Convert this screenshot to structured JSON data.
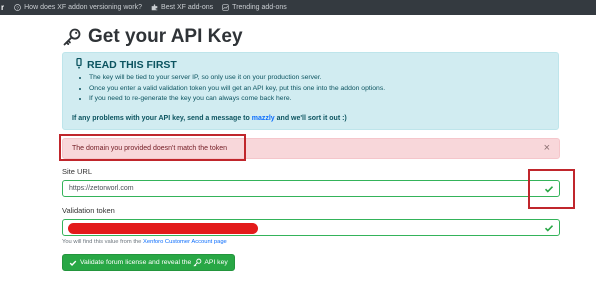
{
  "topnav": {
    "brand": "r",
    "links": [
      {
        "label": "How does XF addon versioning work?",
        "icon": "question-circle-icon"
      },
      {
        "label": "Best XF add-ons",
        "icon": "puzzle-icon"
      },
      {
        "label": "Trending add-ons",
        "icon": "trending-icon"
      }
    ]
  },
  "page": {
    "title": "Get your API Key",
    "title_icon": "key-icon"
  },
  "info": {
    "heading": "READ THIS FIRST",
    "heading_icon": "exclamation-icon",
    "items": [
      "The key will be tied to your server IP, so only use it on your production server.",
      "Once you enter a valid validation token you will get an API key, put this one into the addon options.",
      "If you need to re-generate the key you can always come back here."
    ],
    "footnote_before": "If any problems with your API key, send a message to",
    "footnote_link": "mazzly",
    "footnote_after": "and we'll sort it out :)"
  },
  "alert": {
    "message": "The domain you provided doesn't match the token",
    "close_glyph": "×"
  },
  "form": {
    "site_url_label": "Site URL",
    "site_url_value": "https://zetorworl.com",
    "token_label": "Validation token",
    "token_value": "",
    "help_before": "You will find this value from the",
    "help_link": "Xenforo Customer Account page",
    "submit_before": "Validate forum license and reveal the",
    "submit_after": "API key"
  },
  "colors": {
    "success": "#28a745",
    "info_bg": "#d1ecf1",
    "danger_bg": "#f8d7da",
    "annotation_red": "#c0262c",
    "redaction_red": "#e31b1b"
  }
}
